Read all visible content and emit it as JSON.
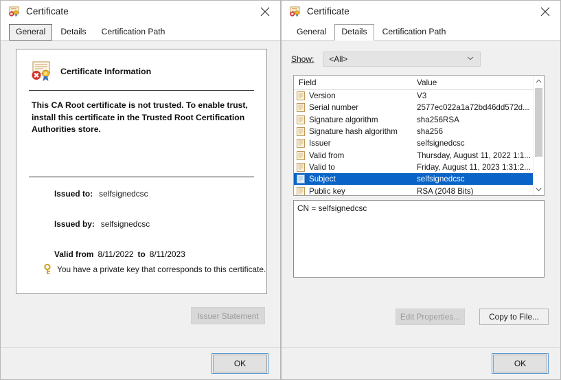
{
  "left_dialog": {
    "titlebar": {
      "title": "Certificate",
      "icon": "certificate-untrusted-icon",
      "close_label": "✕"
    },
    "tabs": [
      {
        "label": "General",
        "active": true
      },
      {
        "label": "Details",
        "active": false
      },
      {
        "label": "Certification Path",
        "active": false
      }
    ],
    "panel": {
      "heading": "Certificate Information",
      "heading_icon": "certificate-error-seal-icon",
      "warning": "This CA Root certificate is not trusted. To enable trust, install this certificate in the Trusted Root Certification Authorities store.",
      "issued_to_label": "Issued to:",
      "issued_to_value": "selfsignedcsc",
      "issued_by_label": "Issued by:",
      "issued_by_value": "selfsignedcsc",
      "valid_from_label": "Valid from",
      "valid_from_value": "8/11/2022",
      "valid_to_label": "to",
      "valid_to_value": "8/11/2023",
      "private_key_note": "You have a private key that corresponds to this certificate.",
      "private_key_icon": "key-icon"
    },
    "issuer_statement_button": "Issuer Statement",
    "ok_button": "OK"
  },
  "right_dialog": {
    "titlebar": {
      "title": "Certificate",
      "icon": "certificate-untrusted-icon",
      "close_label": "✕"
    },
    "tabs": [
      {
        "label": "General",
        "active": false
      },
      {
        "label": "Details",
        "active": true
      },
      {
        "label": "Certification Path",
        "active": false
      }
    ],
    "show": {
      "label": "Show:",
      "value": "<All>",
      "chevron_icon": "chevron-down-icon"
    },
    "grid": {
      "columns": [
        "Field",
        "Value"
      ],
      "rows": [
        {
          "field": "Version",
          "value": "V3",
          "selected": false
        },
        {
          "field": "Serial number",
          "value": "2577ec022a1a72bd46dd572d...",
          "selected": false
        },
        {
          "field": "Signature algorithm",
          "value": "sha256RSA",
          "selected": false
        },
        {
          "field": "Signature hash algorithm",
          "value": "sha256",
          "selected": false
        },
        {
          "field": "Issuer",
          "value": "selfsignedcsc",
          "selected": false
        },
        {
          "field": "Valid from",
          "value": "Thursday, August 11, 2022 1:1...",
          "selected": false
        },
        {
          "field": "Valid to",
          "value": "Friday, August 11, 2023 1:31:2...",
          "selected": false
        },
        {
          "field": "Subject",
          "value": "selfsignedcsc",
          "selected": true
        },
        {
          "field": "Public key",
          "value": "RSA (2048 Bits)",
          "selected": false
        }
      ],
      "scroll_up_icon": "chevron-up-icon",
      "scroll_down_icon": "chevron-down-icon"
    },
    "detail_value": "CN = selfsignedcsc",
    "edit_properties_button": "Edit Properties...",
    "copy_to_file_button": "Copy to File...",
    "ok_button": "OK"
  },
  "colors": {
    "selection_blue": "#0a64c8",
    "focus_border": "#5b9bd5",
    "dialog_bg": "#f0f0f0",
    "panel_white": "#ffffff"
  }
}
